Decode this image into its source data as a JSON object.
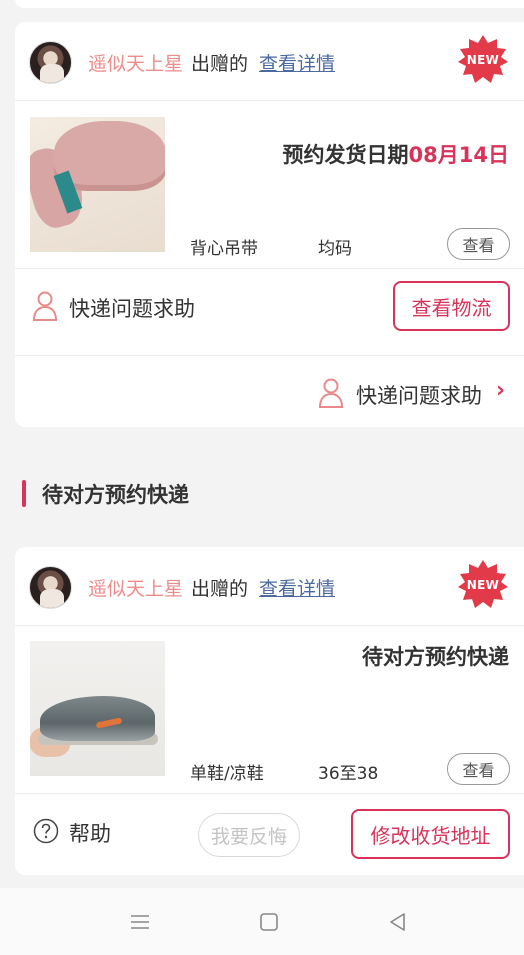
{
  "cards": [
    {
      "giver_name": "遥似天上星",
      "gave_text": "出赠的",
      "detail_link": "查看详情",
      "badge": "NEW",
      "status_prefix": "预约发货日期",
      "status_highlight": "08月14日",
      "category": "背心吊带",
      "size": "均码",
      "view_label": "查看",
      "help_label": "快递问题求助",
      "action_label": "查看物流",
      "footer_help_label": "快递问题求助"
    },
    {
      "giver_name": "遥似天上星",
      "gave_text": "出赠的",
      "detail_link": "查看详情",
      "badge": "NEW",
      "status_text": "待对方预约快递",
      "category": "单鞋/凉鞋",
      "size": "36至38",
      "view_label": "查看",
      "help_label": "帮助",
      "regret_label": "我要反悔",
      "action_label": "修改收货地址"
    }
  ],
  "section": {
    "title": "待对方预约快递"
  },
  "colors": {
    "accent": "#d9335a",
    "giver": "#ee8c8c",
    "link": "#4a6aa0"
  },
  "navbar": {
    "icons": [
      "menu-icon",
      "home-square-icon",
      "back-triangle-icon"
    ]
  }
}
